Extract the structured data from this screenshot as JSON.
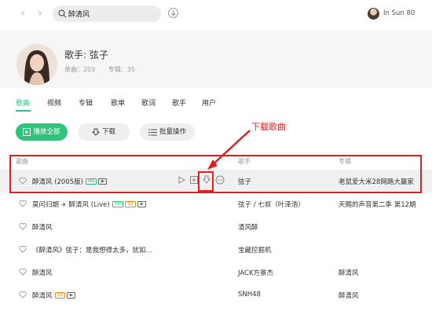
{
  "search": {
    "value": "醉清风"
  },
  "user": {
    "name": "In Sun 80"
  },
  "artist": {
    "name": "歌手: 弦子",
    "singles": "单曲：203",
    "albums": "专辑：35"
  },
  "tabs": [
    {
      "label": "歌曲",
      "active": true
    },
    {
      "label": "视频"
    },
    {
      "label": "专辑"
    },
    {
      "label": "歌单"
    },
    {
      "label": "歌词"
    },
    {
      "label": "歌手"
    },
    {
      "label": "用户"
    }
  ],
  "actions": {
    "play_all": "播放全部",
    "download": "下载",
    "batch": "批量操作"
  },
  "annotation": {
    "label": "下载歌曲"
  },
  "columns": {
    "song": "歌曲",
    "singer": "歌手",
    "album": "专辑"
  },
  "rows": [
    {
      "title": "醉清风 (2005版)",
      "tags": [
        "HQ",
        "MV"
      ],
      "singer": "弦子",
      "album": "老鼠爱大米28网路大赢家"
    },
    {
      "title": "莫问归期 + 醉清风 (Live)",
      "tags": [
        "VIP",
        "SQ",
        "MV"
      ],
      "singer": "弦子 / 七叔（叶泽浩）",
      "album": "天赐的声音第二季 第12期"
    },
    {
      "title": "醉清风",
      "tags": [],
      "singer": "清风醉",
      "album": ""
    },
    {
      "title": "《醉清风》弦子：是我想得太多，犹如...",
      "tags": [],
      "singer": "宝藏挖掘机",
      "album": ""
    },
    {
      "title": "醉清风",
      "tags": [],
      "singer": "JACK方景杰",
      "album": "醉清风"
    },
    {
      "title": "醉清风",
      "tags": [
        "SQ",
        "MV"
      ],
      "singer": "SNH48",
      "album": "醉清风"
    }
  ],
  "colors": {
    "accent": "#31c27c",
    "annotation": "#e02020",
    "sq": "#f08c1e"
  },
  "icons": [
    "back-arrow-icon",
    "forward-arrow-icon",
    "search-icon",
    "download-icon",
    "play-icon",
    "add-icon",
    "more-icon",
    "heart-icon",
    "list-icon"
  ]
}
